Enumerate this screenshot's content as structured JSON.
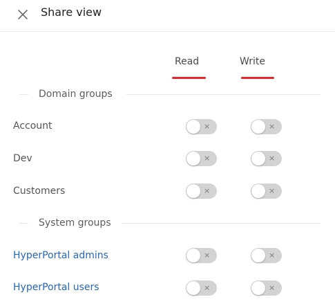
{
  "dialog": {
    "title": "Share view",
    "close_icon": "close-icon"
  },
  "columns": {
    "read": "Read",
    "write": "Write",
    "underline_color": "#e8262a"
  },
  "sections": {
    "domain": {
      "label": "Domain groups",
      "rows": [
        {
          "label": "Account",
          "read": false,
          "write": false
        },
        {
          "label": "Dev",
          "read": false,
          "write": false
        },
        {
          "label": "Customers",
          "read": false,
          "write": false
        }
      ]
    },
    "system": {
      "label": "System groups",
      "rows": [
        {
          "label": "HyperPortal admins",
          "read": false,
          "write": false
        },
        {
          "label": "HyperPortal users",
          "read": false,
          "write": false
        }
      ]
    }
  },
  "toggle": {
    "off_glyph": "×",
    "off_color": "#d3d3d3"
  },
  "link_color": "#2466c2"
}
